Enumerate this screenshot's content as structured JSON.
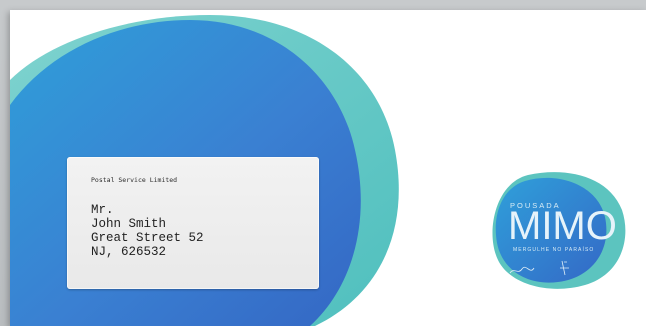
{
  "address_window": {
    "sender": "Postal Service Limited",
    "lines": [
      "Mr.",
      "John Smith",
      "Great Street 52",
      "NJ, 626532"
    ]
  },
  "logo": {
    "top_text": "POUSADA",
    "main_text": "MIMO",
    "sub_text": "MERGULHE NO PARAÍSO"
  },
  "colors": {
    "brand_blue": "#3b78cc",
    "brand_teal": "#5cc4bf",
    "envelope": "#ffffff"
  }
}
